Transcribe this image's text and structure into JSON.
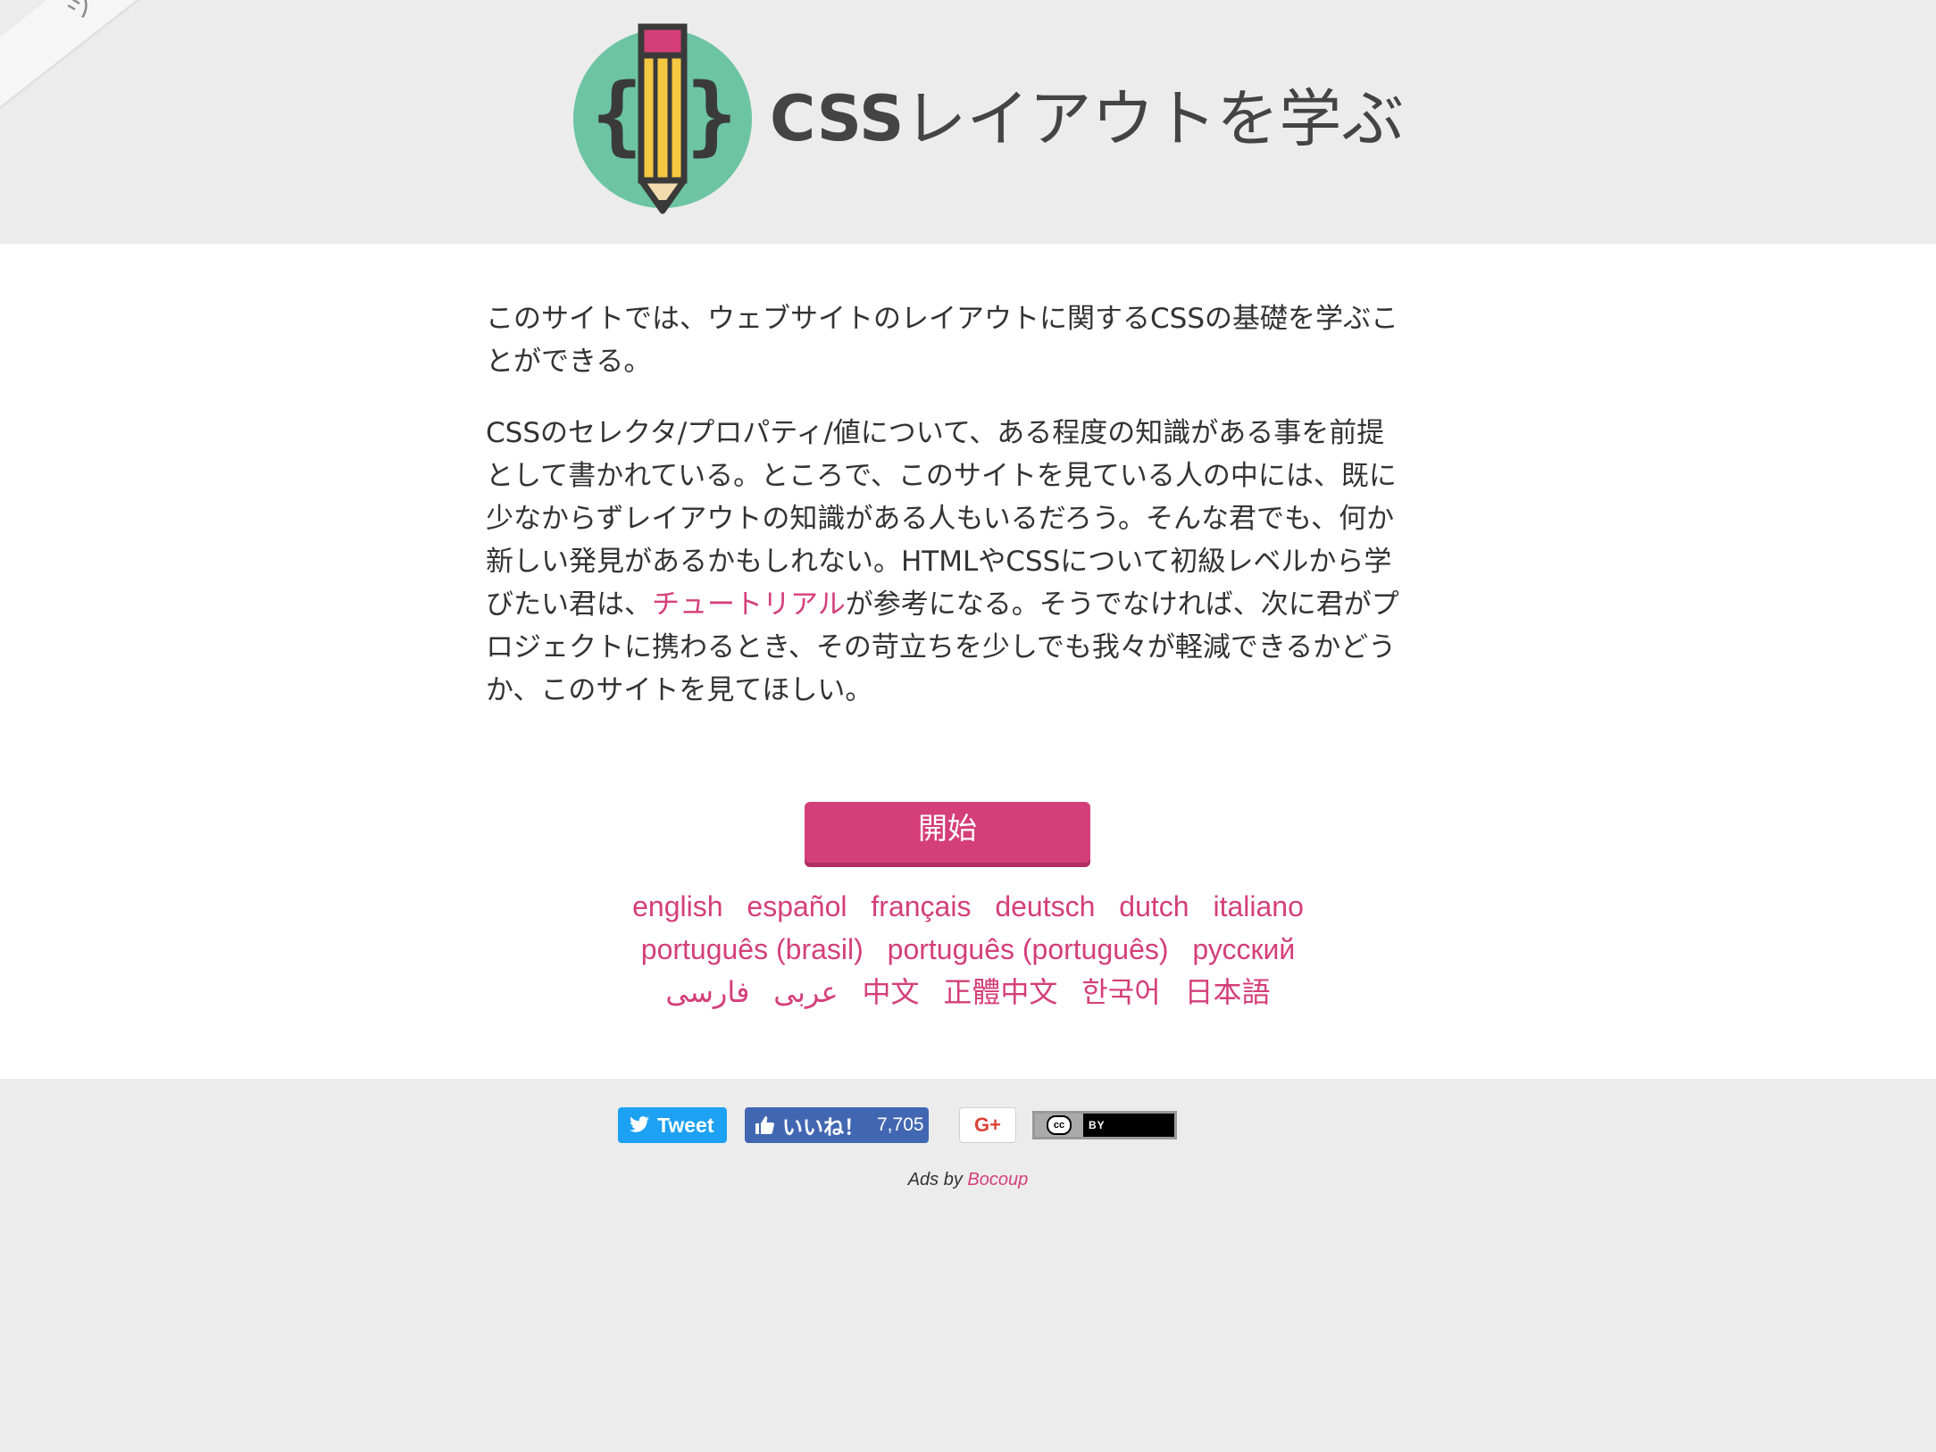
{
  "corner": {
    "label": "ツ一覧"
  },
  "header": {
    "title_css": "CSS",
    "title_rest": "レイアウトを学ぶ"
  },
  "intro": {
    "p1": "このサイトでは、ウェブサイトのレイアウトに関するCSSの基礎を学ぶことができる。",
    "p2_before": "CSSのセレクタ/プロパティ/値について、ある程度の知識がある事を前提として書かれている。ところで、このサイトを見ている人の中には、既に少なからずレイアウトの知識がある人もいるだろう。そんな君でも、何か新しい発見があるかもしれない。HTMLやCSSについて初級レベルから学びたい君は、",
    "p2_link": "チュートリアル",
    "p2_after": "が参考になる。そうでなければ、次に君がプロジェクトに携わるとき、その苛立ちを少しでも我々が軽減できるかどうか、このサイトを見てほしい。"
  },
  "start_button": "開始",
  "languages": {
    "row1": [
      "english",
      "español",
      "français",
      "deutsch",
      "dutch",
      "italiano"
    ],
    "row2": [
      "português (brasil)",
      "português (português)",
      "русский"
    ],
    "row3": [
      "عربى",
      "فارسی",
      "中文",
      "正體中文",
      "한국어",
      "日本語"
    ]
  },
  "footer": {
    "tweet_label": "Tweet",
    "like_label": "いいね！",
    "like_count": "7,705",
    "gplus_label": "G+",
    "cc_label": "BY",
    "cc_circle": "cc",
    "ads_prefix": "Ads by ",
    "ads_link": "Bocoup"
  },
  "colors": {
    "accent": "#d43f79",
    "logo_circle": "#6cc4a4",
    "pencil_yellow": "#f5c842",
    "twitter": "#1da1f2",
    "facebook": "#4267b2"
  }
}
